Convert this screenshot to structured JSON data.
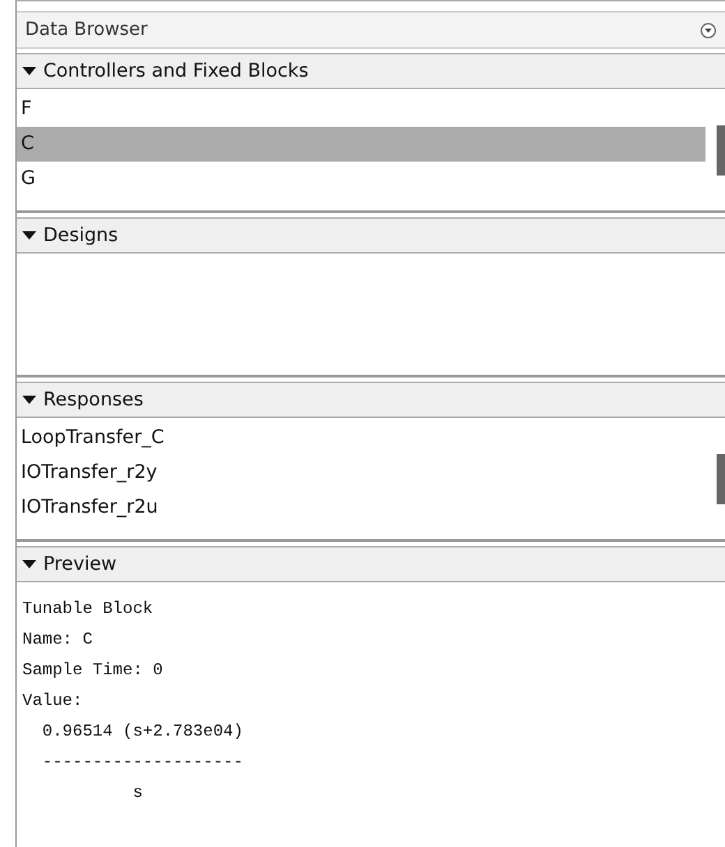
{
  "window": {
    "title": "Data Browser"
  },
  "sections": [
    {
      "title": "Controllers and Fixed Blocks",
      "expanded": true,
      "kind": "list",
      "items": [
        {
          "label": "F",
          "selected": false
        },
        {
          "label": "C",
          "selected": true
        },
        {
          "label": "G",
          "selected": false
        }
      ]
    },
    {
      "title": "Designs",
      "expanded": true,
      "kind": "list"
    },
    {
      "title": "Responses",
      "expanded": true,
      "kind": "list",
      "items": [
        {
          "label": "LoopTransfer_C",
          "selected": false
        },
        {
          "label": "IOTransfer_r2y",
          "selected": false
        },
        {
          "label": "IOTransfer_r2u",
          "selected": false
        }
      ]
    },
    {
      "title": "Preview",
      "expanded": true,
      "kind": "text",
      "lines": [
        "Tunable Block",
        "Name: C",
        "Sample Time: 0",
        "Value:",
        "  0.96514 (s+2.783e04)",
        "  --------------------",
        "           s"
      ]
    }
  ]
}
